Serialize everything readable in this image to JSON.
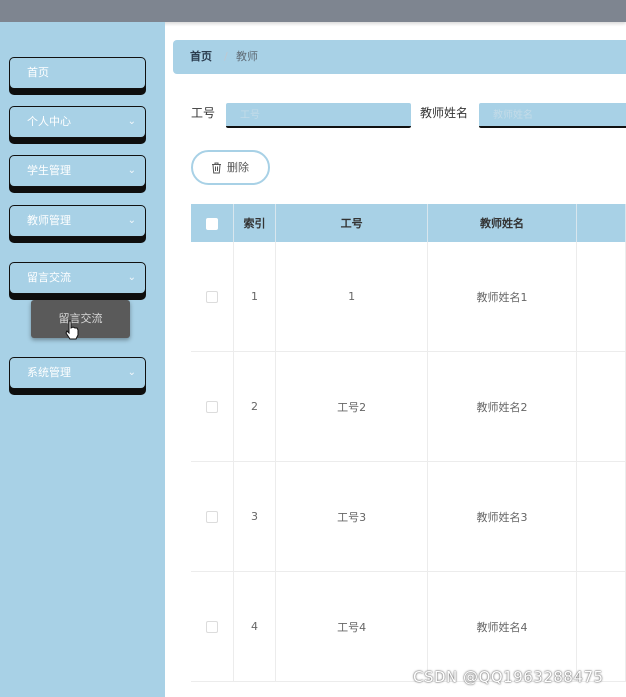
{
  "sidebar": {
    "items": [
      {
        "label": "首页",
        "has_chevron": false
      },
      {
        "label": "个人中心",
        "has_chevron": true
      },
      {
        "label": "学生管理",
        "has_chevron": true
      },
      {
        "label": "教师管理",
        "has_chevron": true
      },
      {
        "label": "留言交流",
        "has_chevron": true
      },
      {
        "label": "系统管理",
        "has_chevron": true
      }
    ],
    "submenu_item": "留言交流"
  },
  "breadcrumb": {
    "home": "首页",
    "separator": "/",
    "current": "教师"
  },
  "filters": {
    "id_label": "工号",
    "id_placeholder": "工号",
    "name_label": "教师姓名",
    "name_placeholder": "教师姓名"
  },
  "toolbar": {
    "delete_label": "删除"
  },
  "table": {
    "headers": [
      "索引",
      "工号",
      "教师姓名"
    ],
    "rows": [
      {
        "index": "1",
        "id": "1",
        "name": "教师姓名1"
      },
      {
        "index": "2",
        "id": "工号2",
        "name": "教师姓名2"
      },
      {
        "index": "3",
        "id": "工号3",
        "name": "教师姓名3"
      },
      {
        "index": "4",
        "id": "工号4",
        "name": "教师姓名4"
      }
    ]
  },
  "watermark": "CSDN @QQ1963288475",
  "colors": {
    "accent": "#a8d1e6",
    "topbar": "#7e8590",
    "submenu": "#5a5a5a"
  }
}
